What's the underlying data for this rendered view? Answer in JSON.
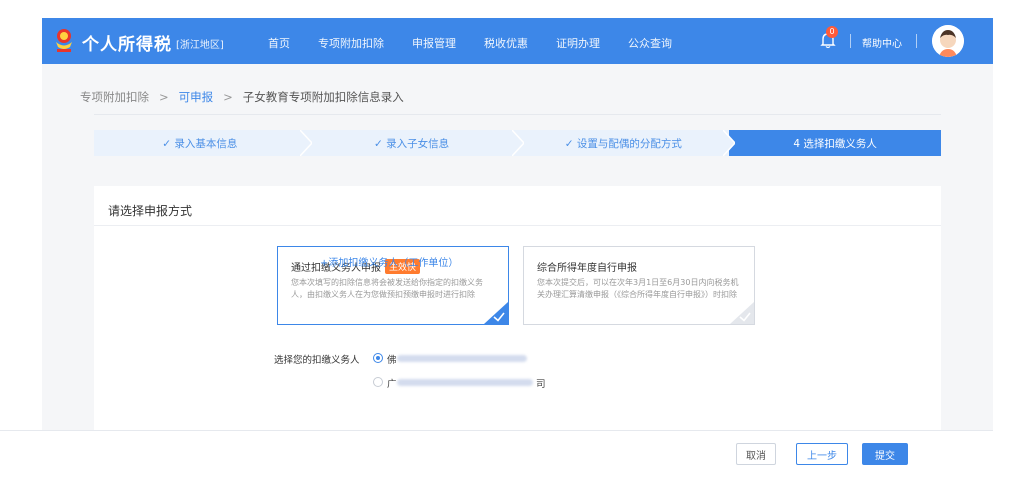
{
  "header": {
    "brand": "个人所得税",
    "region": "[浙江地区]",
    "nav": [
      "首页",
      "专项附加扣除",
      "申报管理",
      "税收优惠",
      "证明办理",
      "公众查询"
    ],
    "notification_count": "0",
    "help": "帮助中心"
  },
  "breadcrumb": {
    "root": "专项附加扣除",
    "middle": "可申报",
    "current": "子女教育专项附加扣除信息录入"
  },
  "steps": [
    {
      "label": "✓ 录入基本信息",
      "state": "done"
    },
    {
      "label": "✓ 录入子女信息",
      "state": "done"
    },
    {
      "label": "✓ 设置与配偶的分配方式",
      "state": "done"
    },
    {
      "label": "4 选择扣缴义务人",
      "state": "active"
    }
  ],
  "form": {
    "section_title": "请选择申报方式",
    "option_employer": {
      "title": "通过扣缴义务人申报",
      "badge": "生效快",
      "desc": "您本次填写的扣除信息将会被发送给你指定的扣缴义务人，由扣缴义务人在为您做预扣预缴申报时进行扣除",
      "selected": true
    },
    "option_self": {
      "title": "综合所得年度自行申报",
      "desc": "您本次提交后，可以在次年3月1日至6月30日内向税务机关办理汇算清缴申报（《综合所得年度自行申报》）时扣除",
      "selected": false
    },
    "agent_label": "选择您的扣缴义务人",
    "agents": [
      {
        "prefix": "佛",
        "suffix": "",
        "selected": true
      },
      {
        "prefix": "广",
        "suffix": "司",
        "selected": false
      }
    ],
    "add_agent": "+添加扣缴义务人（工作单位）"
  },
  "footer": {
    "cancel": "取消",
    "prev": "上一步",
    "submit": "提交"
  },
  "colors": {
    "primary": "#3d87e8",
    "badge": "#ff7b2e",
    "step_inactive_bg": "#eaf2fc"
  }
}
